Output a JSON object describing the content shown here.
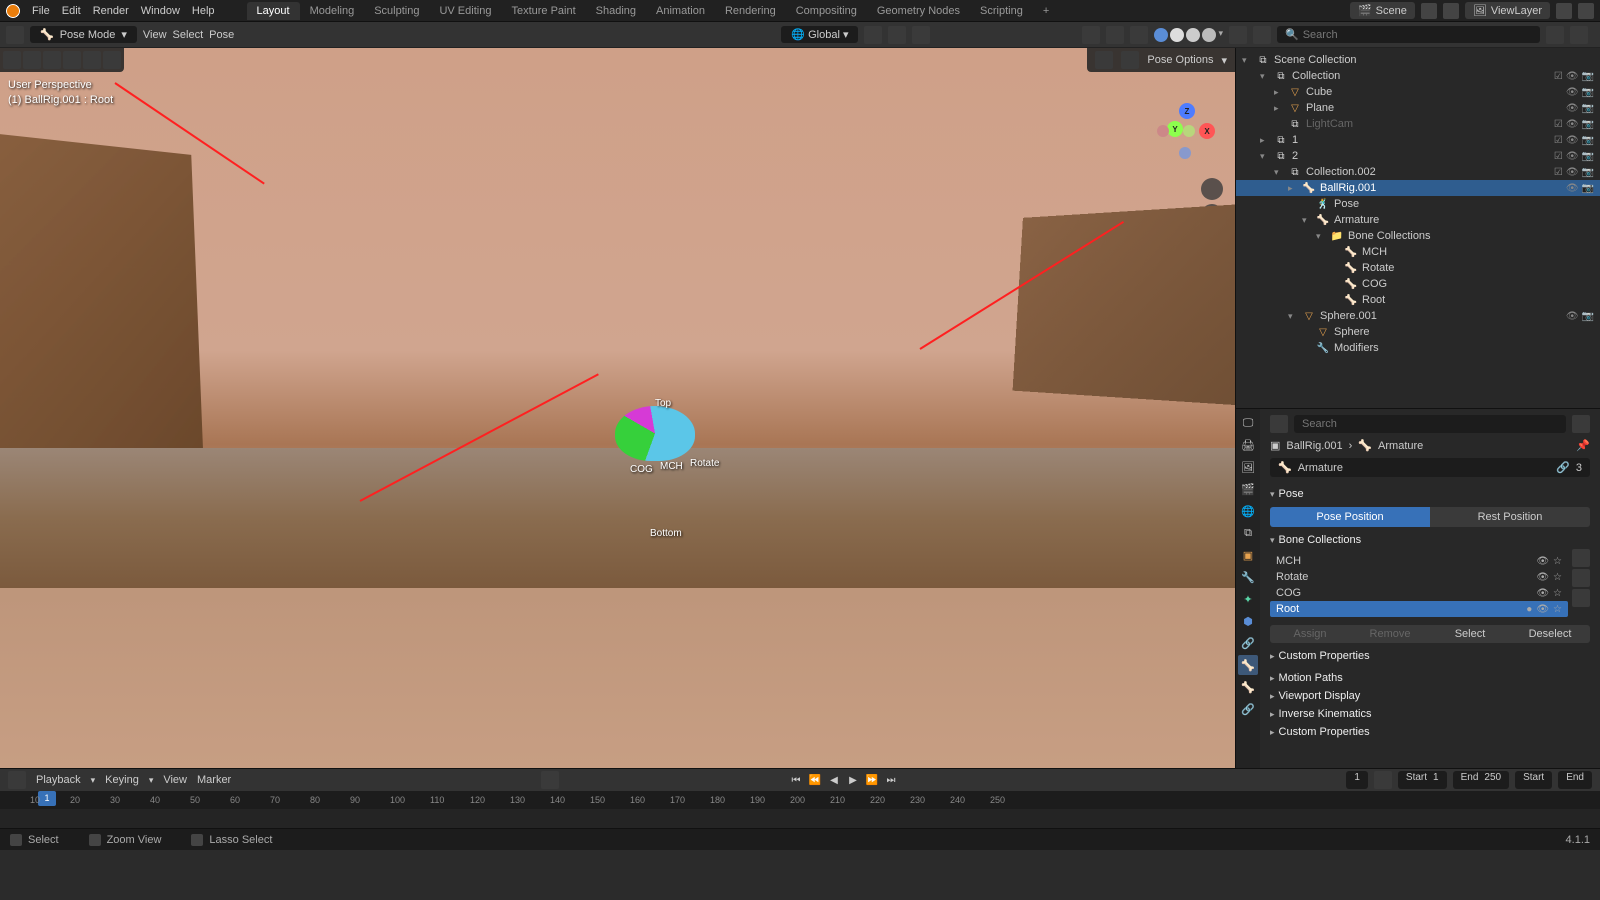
{
  "menubar": {
    "menus": [
      "File",
      "Edit",
      "Render",
      "Window",
      "Help"
    ],
    "tabs": [
      "Layout",
      "Modeling",
      "Sculpting",
      "UV Editing",
      "Texture Paint",
      "Shading",
      "Animation",
      "Rendering",
      "Compositing",
      "Geometry Nodes",
      "Scripting"
    ],
    "active_tab": 0,
    "scene": "Scene",
    "viewlayer": "ViewLayer"
  },
  "header2": {
    "mode": "Pose Mode",
    "view_menu": "View",
    "select_menu": "Select",
    "pose_menu": "Pose",
    "orientation": "Global"
  },
  "viewport": {
    "overlay_line1": "User Perspective",
    "overlay_line2": "(1) BallRig.001 : Root",
    "pose_options": "Pose Options",
    "bone_top": "Top",
    "bone_cog": "COG",
    "bone_mch": "MCH",
    "bone_rotate": "Rotate",
    "bone_bottom": "Bottom",
    "gizmo": {
      "z": "Z",
      "y": "Y",
      "x": "X"
    }
  },
  "outliner": {
    "search_placeholder": "Search",
    "root": "Scene Collection",
    "items": [
      {
        "label": "Collection",
        "depth": 1,
        "type": "collection",
        "expanded": true
      },
      {
        "label": "Cube",
        "depth": 2,
        "type": "mesh"
      },
      {
        "label": "Plane",
        "depth": 2,
        "type": "mesh"
      },
      {
        "label": "LightCam",
        "depth": 2,
        "type": "collection-greyed"
      },
      {
        "label": "1",
        "depth": 1,
        "type": "collection"
      },
      {
        "label": "2",
        "depth": 1,
        "type": "collection",
        "expanded": true
      },
      {
        "label": "Collection.002",
        "depth": 2,
        "type": "collection",
        "expanded": true
      },
      {
        "label": "BallRig.001",
        "depth": 3,
        "type": "armature-obj",
        "selected": true
      },
      {
        "label": "Pose",
        "depth": 4,
        "type": "pose"
      },
      {
        "label": "Armature",
        "depth": 4,
        "type": "armature",
        "expanded": true
      },
      {
        "label": "Bone Collections",
        "depth": 5,
        "type": "group",
        "expanded": true
      },
      {
        "label": "MCH",
        "depth": 6,
        "type": "bone-coll"
      },
      {
        "label": "Rotate",
        "depth": 6,
        "type": "bone-coll"
      },
      {
        "label": "COG",
        "depth": 6,
        "type": "bone-coll"
      },
      {
        "label": "Root",
        "depth": 6,
        "type": "bone-coll"
      },
      {
        "label": "Sphere.001",
        "depth": 3,
        "type": "mesh",
        "expanded": true
      },
      {
        "label": "Sphere",
        "depth": 4,
        "type": "meshdata"
      },
      {
        "label": "Modifiers",
        "depth": 4,
        "type": "modifiers"
      }
    ]
  },
  "properties": {
    "search_placeholder": "Search",
    "breadcrumb_obj": "BallRig.001",
    "breadcrumb_data": "Armature",
    "data_name": "Armature",
    "data_users": "3",
    "sections": {
      "pose": "Pose",
      "pose_position": "Pose Position",
      "rest_position": "Rest Position",
      "bone_collections": "Bone Collections",
      "custom_properties": "Custom Properties",
      "motion_paths": "Motion Paths",
      "viewport_display": "Viewport Display",
      "inverse_kinematics": "Inverse Kinematics",
      "custom_properties2": "Custom Properties"
    },
    "bone_list": [
      "MCH",
      "Rotate",
      "COG",
      "Root"
    ],
    "selected_bone": 3,
    "buttons": {
      "assign": "Assign",
      "remove": "Remove",
      "select": "Select",
      "deselect": "Deselect"
    }
  },
  "timeline": {
    "menus": [
      "Playback",
      "Keying",
      "View",
      "Marker"
    ],
    "frame_current": "1",
    "start_label": "Start",
    "start_val": "1",
    "end_label": "End",
    "end_val": "250",
    "start2_label": "Start",
    "end2_label": "End",
    "ticks": [
      "10",
      "20",
      "30",
      "40",
      "50",
      "60",
      "70",
      "80",
      "90",
      "100",
      "110",
      "120",
      "130",
      "140",
      "150",
      "160",
      "170",
      "180",
      "190",
      "200",
      "210",
      "220",
      "230",
      "240",
      "250"
    ],
    "playhead": "1"
  },
  "statusbar": {
    "select": "Select",
    "zoom": "Zoom View",
    "lasso": "Lasso Select",
    "version": "4.1.1"
  }
}
